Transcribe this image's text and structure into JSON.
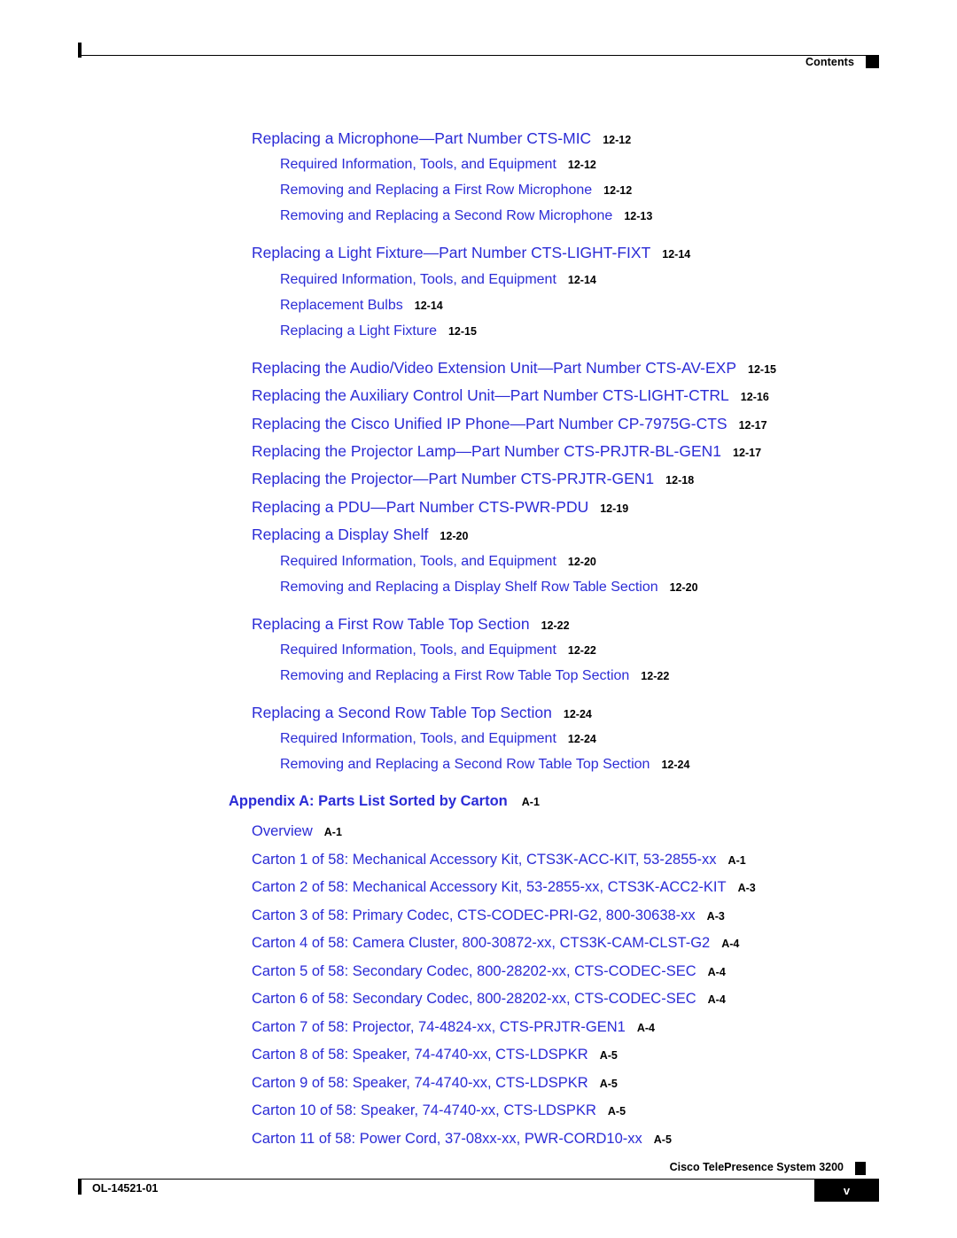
{
  "header": {
    "label": "Contents"
  },
  "toc": {
    "groups": [
      {
        "entries": [
          {
            "level": 1,
            "title": "Replacing a Microphone—Part Number CTS-MIC",
            "page": "12-12"
          },
          {
            "level": 2,
            "title": "Required Information, Tools, and Equipment",
            "page": "12-12"
          },
          {
            "level": 2,
            "title": "Removing and Replacing a First Row Microphone",
            "page": "12-12"
          },
          {
            "level": 2,
            "title": "Removing and Replacing a Second Row Microphone",
            "page": "12-13"
          }
        ]
      },
      {
        "entries": [
          {
            "level": 1,
            "title": "Replacing a Light Fixture—Part Number CTS-LIGHT-FIXT",
            "page": "12-14"
          },
          {
            "level": 2,
            "title": "Required Information, Tools, and Equipment",
            "page": "12-14"
          },
          {
            "level": 2,
            "title": "Replacement Bulbs",
            "page": "12-14"
          },
          {
            "level": 2,
            "title": "Replacing a Light Fixture",
            "page": "12-15"
          }
        ]
      },
      {
        "entries": [
          {
            "level": 1,
            "title": "Replacing the Audio/Video Extension Unit—Part Number CTS-AV-EXP",
            "page": "12-15"
          },
          {
            "level": 1,
            "title": "Replacing the Auxiliary Control Unit—Part Number CTS-LIGHT-CTRL",
            "page": "12-16"
          },
          {
            "level": 1,
            "title": "Replacing the Cisco Unified IP Phone—Part Number CP-7975G-CTS",
            "page": "12-17"
          },
          {
            "level": 1,
            "title": "Replacing the Projector Lamp—Part Number CTS-PRJTR-BL-GEN1",
            "page": "12-17"
          },
          {
            "level": 1,
            "title": "Replacing the Projector—Part Number CTS-PRJTR-GEN1",
            "page": "12-18"
          },
          {
            "level": 1,
            "title": "Replacing a PDU—Part Number CTS-PWR-PDU",
            "page": "12-19"
          },
          {
            "level": 1,
            "title": "Replacing a Display Shelf",
            "page": "12-20"
          },
          {
            "level": 2,
            "title": "Required Information, Tools, and Equipment",
            "page": "12-20"
          },
          {
            "level": 2,
            "title": "Removing and Replacing a Display Shelf Row Table Section",
            "page": "12-20"
          }
        ]
      },
      {
        "entries": [
          {
            "level": 1,
            "title": "Replacing a First Row Table Top Section",
            "page": "12-22"
          },
          {
            "level": 2,
            "title": "Required Information, Tools, and Equipment",
            "page": "12-22"
          },
          {
            "level": 2,
            "title": "Removing and Replacing a First Row Table Top Section",
            "page": "12-22"
          }
        ]
      },
      {
        "entries": [
          {
            "level": 1,
            "title": "Replacing a Second Row Table Top Section",
            "page": "12-24"
          },
          {
            "level": 2,
            "title": "Required Information, Tools, and Equipment",
            "page": "12-24"
          },
          {
            "level": 2,
            "title": "Removing and Replacing a Second Row Table Top Section",
            "page": "12-24"
          }
        ]
      }
    ],
    "appendix": {
      "title": "Appendix A: Parts List Sorted by Carton",
      "page": "A-1",
      "entries": [
        {
          "title": "Overview",
          "page": "A-1"
        },
        {
          "title": "Carton 1 of 58: Mechanical Accessory Kit, CTS3K-ACC-KIT, 53-2855-xx",
          "page": "A-1"
        },
        {
          "title": "Carton 2 of 58: Mechanical Accessory Kit, 53-2855-xx, CTS3K-ACC2-KIT",
          "page": "A-3"
        },
        {
          "title": "Carton 3 of 58: Primary Codec, CTS-CODEC-PRI-G2, 800-30638-xx",
          "page": "A-3"
        },
        {
          "title": "Carton 4 of 58: Camera Cluster, 800-30872-xx, CTS3K-CAM-CLST-G2",
          "page": "A-4"
        },
        {
          "title": "Carton 5 of 58: Secondary Codec, 800-28202-xx, CTS-CODEC-SEC",
          "page": "A-4"
        },
        {
          "title": "Carton 6 of 58: Secondary Codec, 800-28202-xx, CTS-CODEC-SEC",
          "page": "A-4"
        },
        {
          "title": "Carton 7 of 58: Projector, 74-4824-xx, CTS-PRJTR-GEN1",
          "page": "A-4"
        },
        {
          "title": "Carton 8 of 58: Speaker, 74-4740-xx, CTS-LDSPKR",
          "page": "A-5"
        },
        {
          "title": "Carton 9 of 58: Speaker, 74-4740-xx, CTS-LDSPKR",
          "page": "A-5"
        },
        {
          "title": "Carton 10 of 58: Speaker, 74-4740-xx, CTS-LDSPKR",
          "page": "A-5"
        },
        {
          "title": "Carton 11 of 58: Power Cord, 37-08xx-xx, PWR-CORD10-xx",
          "page": "A-5"
        }
      ]
    }
  },
  "footer": {
    "document_id": "OL-14521-01",
    "product_label": "Cisco TelePresence System 3200",
    "page_number": "v"
  },
  "colors": {
    "link_blue": "#2B2BD6",
    "text_black": "#000000",
    "page_box_background": "#000000"
  }
}
